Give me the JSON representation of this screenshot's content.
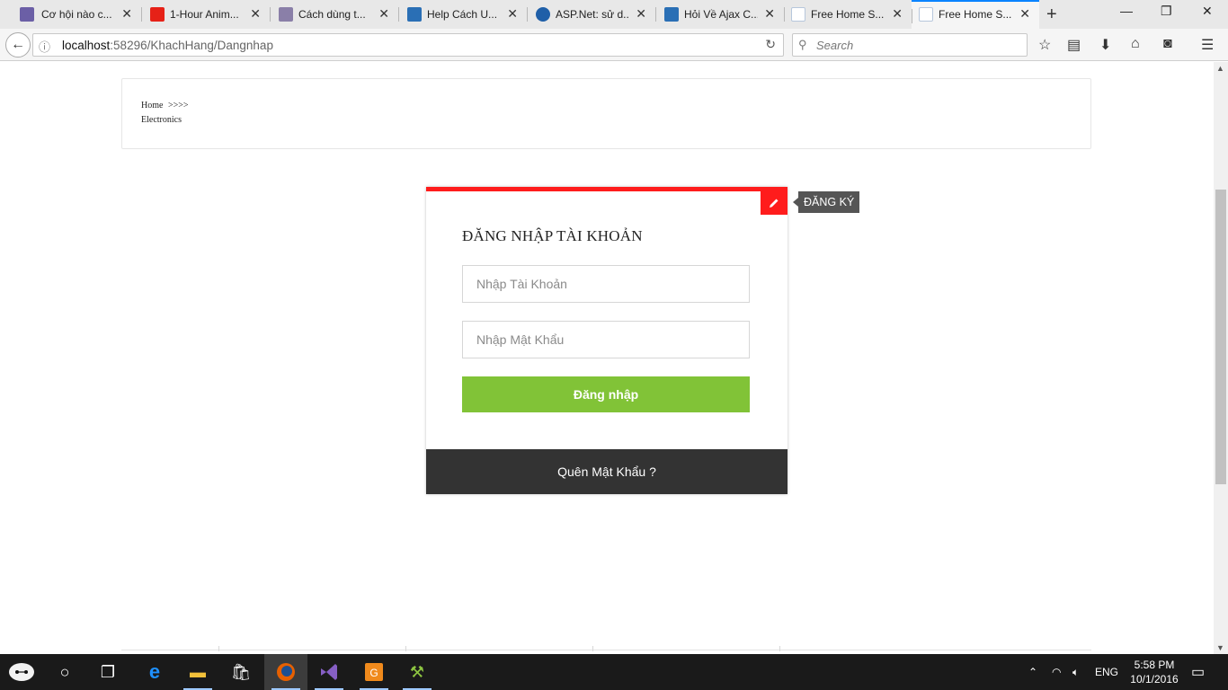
{
  "browser": {
    "tabs": [
      {
        "title": "Cơ hội nào c...",
        "favicon_color": "#6b5fa6"
      },
      {
        "title": "1-Hour Anim...",
        "favicon_color": "#e62117"
      },
      {
        "title": "Cách dùng t...",
        "favicon_color": "#8a7fa8"
      },
      {
        "title": "Help Cách U...",
        "favicon_color": "#2a6fb5"
      },
      {
        "title": "ASP.Net: sử d...",
        "favicon_color": "#1f5fa8"
      },
      {
        "title": "Hỏi Về Ajax C...",
        "favicon_color": "#2a6fb5"
      },
      {
        "title": "Free Home S...",
        "favicon_color": "#b7c7dc"
      },
      {
        "title": "Free Home S...",
        "favicon_color": "#b7c7dc",
        "active": true
      }
    ],
    "new_tab": "+",
    "window_controls": {
      "minimize": "—",
      "restore": "❐",
      "close": "✕"
    },
    "url": {
      "host": "localhost",
      "rest": ":58296/KhachHang/Dangnhap"
    },
    "search_placeholder": "Search",
    "accent_color": "#0a84ff"
  },
  "breadcrumb": {
    "home": "Home",
    "separator": ">>>>",
    "current": "Electronics"
  },
  "login": {
    "title": "ĐĂNG NHẬP TÀI KHOẢN",
    "username_placeholder": "Nhập Tài Khoản",
    "password_placeholder": "Nhập Mật Khẩu",
    "submit_label": "Đăng nhập",
    "forgot_label": "Quên Mật Khẩu ?",
    "register_tooltip": "ĐĂNG KÝ",
    "accent_color": "#ff1c1c",
    "submit_color": "#81c337",
    "footer_color": "#333333"
  },
  "taskbar": {
    "language": "ENG",
    "time": "5:58 PM",
    "date": "10/1/2016"
  }
}
